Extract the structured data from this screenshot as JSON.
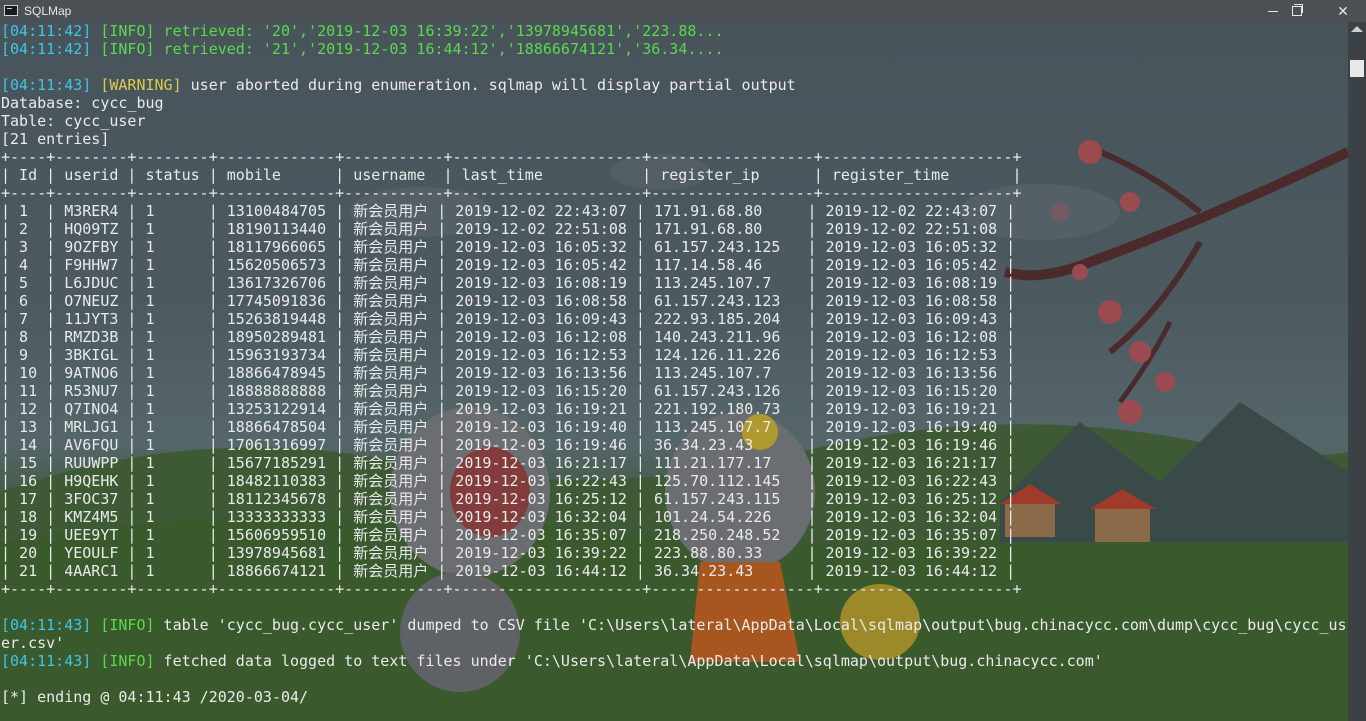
{
  "window": {
    "title": "SQLMap",
    "minimize_label": "—",
    "close_label": "✕"
  },
  "log_top": [
    {
      "ts": "[04:11:42]",
      "level": "[INFO]",
      "text": " retrieved: ",
      "value": "'20','2019-12-03 16:39:22','13978945681','223.88..."
    },
    {
      "ts": "[04:11:42]",
      "level": "[INFO]",
      "text": " retrieved: ",
      "value": "'21','2019-12-03 16:44:12','18866674121','36.34...."
    }
  ],
  "warning_line": {
    "ts": "[04:11:43]",
    "level": "[WARNING]",
    "text": " user aborted during enumeration. sqlmap will display partial output"
  },
  "db_line": "Database: cycc_bug",
  "table_line": "Table: cycc_user",
  "entries_line": "[21 entries]",
  "table": {
    "border_top": "+----+--------+--------+-------------+-----------+---------------------+------------------+---------------------+",
    "header": "| Id | userid | status | mobile      | username  | last_time           | register_ip      | register_time       |",
    "border_mid": "+----+--------+--------+-------------+-----------+---------------------+------------------+---------------------+",
    "rows": [
      "| 1  | M3RER4 | 1      | 13100484705 | 新会员用户 | 2019-12-02 22:43:07 | 171.91.68.80     | 2019-12-02 22:43:07 |",
      "| 2  | HQ09TZ | 1      | 18190113440 | 新会员用户 | 2019-12-02 22:51:08 | 171.91.68.80     | 2019-12-02 22:51:08 |",
      "| 3  | 9OZFBY | 1      | 18117966065 | 新会员用户 | 2019-12-03 16:05:32 | 61.157.243.125   | 2019-12-03 16:05:32 |",
      "| 4  | F9HHW7 | 1      | 15620506573 | 新会员用户 | 2019-12-03 16:05:42 | 117.14.58.46     | 2019-12-03 16:05:42 |",
      "| 5  | L6JDUC | 1      | 13617326706 | 新会员用户 | 2019-12-03 16:08:19 | 113.245.107.7    | 2019-12-03 16:08:19 |",
      "| 6  | O7NEUZ | 1      | 17745091836 | 新会员用户 | 2019-12-03 16:08:58 | 61.157.243.123   | 2019-12-03 16:08:58 |",
      "| 7  | 11JYT3 | 1      | 15263819448 | 新会员用户 | 2019-12-03 16:09:43 | 222.93.185.204   | 2019-12-03 16:09:43 |",
      "| 8  | RMZD3B | 1      | 18950289481 | 新会员用户 | 2019-12-03 16:12:08 | 140.243.211.96   | 2019-12-03 16:12:08 |",
      "| 9  | 3BKIGL | 1      | 15963193734 | 新会员用户 | 2019-12-03 16:12:53 | 124.126.11.226   | 2019-12-03 16:12:53 |",
      "| 10 | 9ATNO6 | 1      | 18866478945 | 新会员用户 | 2019-12-03 16:13:56 | 113.245.107.7    | 2019-12-03 16:13:56 |",
      "| 11 | R53NU7 | 1      | 18888888888 | 新会员用户 | 2019-12-03 16:15:20 | 61.157.243.126   | 2019-12-03 16:15:20 |",
      "| 12 | Q7INO4 | 1      | 13253122914 | 新会员用户 | 2019-12-03 16:19:21 | 221.192.180.73   | 2019-12-03 16:19:21 |",
      "| 13 | MRLJG1 | 1      | 18866478504 | 新会员用户 | 2019-12-03 16:19:40 | 113.245.107.7    | 2019-12-03 16:19:40 |",
      "| 14 | AV6FQU | 1      | 17061316997 | 新会员用户 | 2019-12-03 16:19:46 | 36.34.23.43      | 2019-12-03 16:19:46 |",
      "| 15 | RUUWPP | 1      | 15677185291 | 新会员用户 | 2019-12-03 16:21:17 | 111.21.177.17    | 2019-12-03 16:21:17 |",
      "| 16 | H9QEHK | 1      | 18482110383 | 新会员用户 | 2019-12-03 16:22:43 | 125.70.112.145   | 2019-12-03 16:22:43 |",
      "| 17 | 3FOC37 | 1      | 18112345678 | 新会员用户 | 2019-12-03 16:25:12 | 61.157.243.115   | 2019-12-03 16:25:12 |",
      "| 18 | KMZ4M5 | 1      | 13333333333 | 新会员用户 | 2019-12-03 16:32:04 | 101.24.54.226    | 2019-12-03 16:32:04 |",
      "| 19 | UEE9YT | 1      | 15606959510 | 新会员用户 | 2019-12-03 16:35:07 | 218.250.248.52   | 2019-12-03 16:35:07 |",
      "| 20 | YEOULF | 1      | 13978945681 | 新会员用户 | 2019-12-03 16:39:22 | 223.88.80.33     | 2019-12-03 16:39:22 |",
      "| 21 | 4AARC1 | 1      | 18866674121 | 新会员用户 | 2019-12-03 16:44:12 | 36.34.23.43      | 2019-12-03 16:44:12 |"
    ],
    "border_bottom": "+----+--------+--------+-------------+-----------+---------------------+------------------+---------------------+"
  },
  "log_bottom": [
    {
      "ts": "[04:11:43]",
      "level": "[INFO]",
      "text": " table 'cycc_bug.cycc_user' dumped to CSV file 'C:\\Users\\lateral\\AppData\\Local\\sqlmap\\output\\bug.chinacycc.com\\dump\\cycc_bug\\cycc_us"
    },
    {
      "ts": "",
      "level": "",
      "text": "er.csv'"
    },
    {
      "ts": "[04:11:43]",
      "level": "[INFO]",
      "text": " fetched data logged to text files under 'C:\\Users\\lateral\\AppData\\Local\\sqlmap\\output\\bug.chinacycc.com'"
    }
  ],
  "ending_line": "[*] ending @ 04:11:43 /2020-03-04/"
}
